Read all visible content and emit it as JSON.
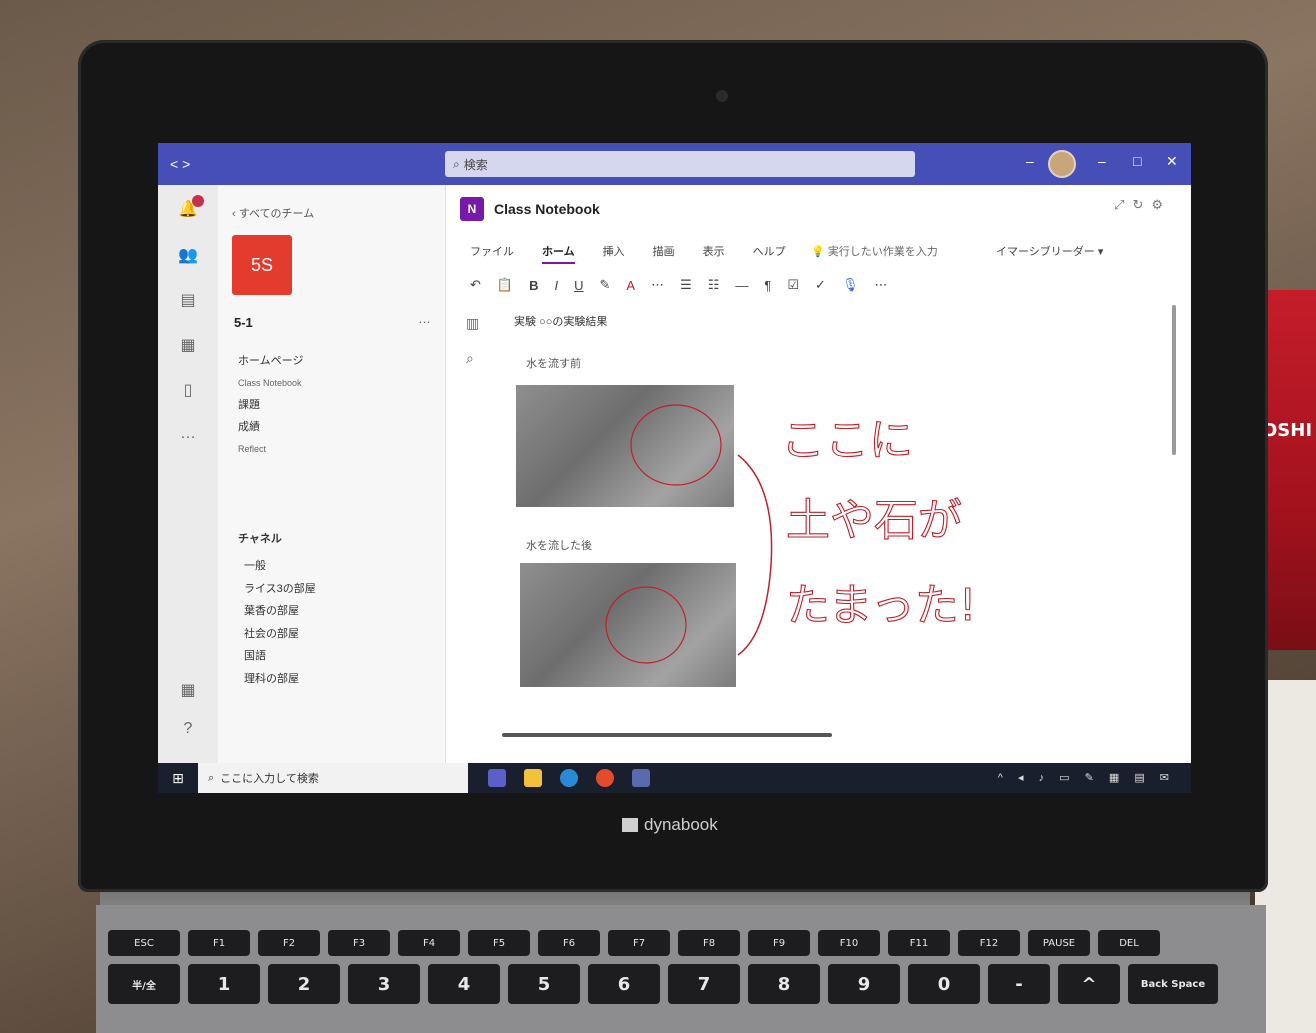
{
  "background": {
    "side_text": "OSHI"
  },
  "laptop": {
    "brand": "dynabook"
  },
  "teams": {
    "search_placeholder": "検索",
    "window_controls": {
      "minimize": "–",
      "maximize": "□",
      "close": "✕"
    },
    "nav_arrows": "< >",
    "back_link": "すべてのチーム",
    "team_tile": "5S",
    "team_name": "5-1",
    "nav_items": [
      "ホームページ",
      "Class Notebook",
      "課題",
      "成績",
      "Reflect"
    ],
    "channels_header": "チャネル",
    "channels": [
      "一般",
      "ライス3の部屋",
      "葉香の部屋",
      "社会の部屋",
      "国語",
      "理科の部屋"
    ]
  },
  "notebook": {
    "title": "Class Notebook",
    "ribbon_tabs": [
      "ファイル",
      "ホーム",
      "挿入",
      "描画",
      "表示",
      "ヘルプ"
    ],
    "active_tab": "ホーム",
    "tell_me": "実行したい作業を入力",
    "immersive": "イマーシブリーダー",
    "page_title": "実験 ○○の実験結果",
    "caption_1": "水を流す前",
    "caption_2": "水を流した後",
    "handwriting": [
      "ここに",
      "土や石が",
      "たまった!"
    ]
  },
  "taskbar": {
    "search": "ここに入力して検索"
  },
  "colors": {
    "teams_purple": "#464eb8",
    "onenote_purple": "#7719aa",
    "team_tile_red": "#e33b2e",
    "ink_red": "#c0202a"
  },
  "icons": [
    "activity-icon",
    "teams-icon",
    "assignments-icon",
    "calendar-icon",
    "files-icon",
    "more-icon",
    "apps-icon",
    "help-icon",
    "search-icon",
    "start-icon"
  ]
}
